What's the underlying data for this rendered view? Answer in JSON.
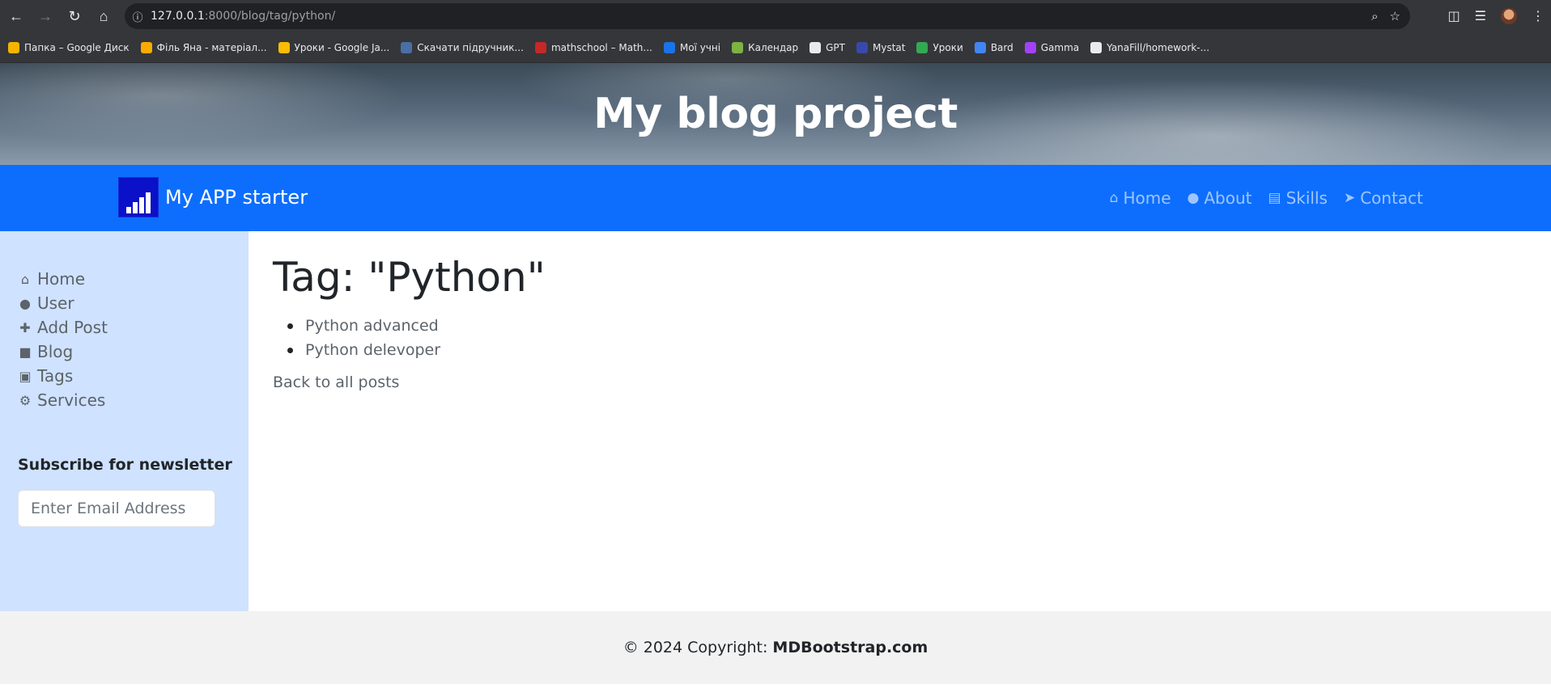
{
  "browser": {
    "url_host": "127.0.0.1",
    "url_rest": ":8000/blog/tag/python/",
    "bookmarks": [
      {
        "label": "Папка – Google Диск",
        "color": "#f4b400"
      },
      {
        "label": "Філь Яна - матеріал...",
        "color": "#f9ab00"
      },
      {
        "label": "Уроки - Google Ja...",
        "color": "#fbbc04"
      },
      {
        "label": "Скачати підручник...",
        "color": "#4a6fa5"
      },
      {
        "label": "mathschool – Math...",
        "color": "#c62828"
      },
      {
        "label": "Мої учні",
        "color": "#1a73e8"
      },
      {
        "label": "Календар",
        "color": "#7cb342"
      },
      {
        "label": "GPT",
        "color": "#e8eaed"
      },
      {
        "label": "Mystat",
        "color": "#3949ab"
      },
      {
        "label": "Уроки",
        "color": "#34a853"
      },
      {
        "label": "Bard",
        "color": "#4285f4"
      },
      {
        "label": "Gamma",
        "color": "#a142f4"
      },
      {
        "label": "YanaFill/homework-...",
        "color": "#e8eaed"
      }
    ]
  },
  "hero": {
    "title": "My blog project"
  },
  "navbar": {
    "brand": "My APP starter",
    "links": [
      {
        "label": "Home",
        "icon": "home-icon"
      },
      {
        "label": "About",
        "icon": "user-icon"
      },
      {
        "label": "Skills",
        "icon": "book-icon"
      },
      {
        "label": "Contact",
        "icon": "paper-plane-icon"
      }
    ]
  },
  "sidebar": {
    "items": [
      {
        "label": "Home",
        "icon": "home-icon"
      },
      {
        "label": "User",
        "icon": "user-icon"
      },
      {
        "label": "Add Post",
        "icon": "plus-icon"
      },
      {
        "label": "Blog",
        "icon": "sticky-note-icon"
      },
      {
        "label": "Tags",
        "icon": "briefcase-icon"
      },
      {
        "label": "Services",
        "icon": "cogs-icon"
      }
    ],
    "newsletter_title": "Subscribe for newsletter",
    "email_placeholder": "Enter Email Address"
  },
  "main": {
    "title": "Tag: \"Python\"",
    "posts": [
      "Python advanced",
      "Python delevoper"
    ],
    "back_link": "Back to all posts"
  },
  "footer": {
    "text": "© 2024 Copyright:",
    "link": "MDBootstrap.com"
  },
  "colors": {
    "navbar": "#0d6efd",
    "sidebar": "#cfe2ff",
    "footer": "#f2f2f2"
  }
}
